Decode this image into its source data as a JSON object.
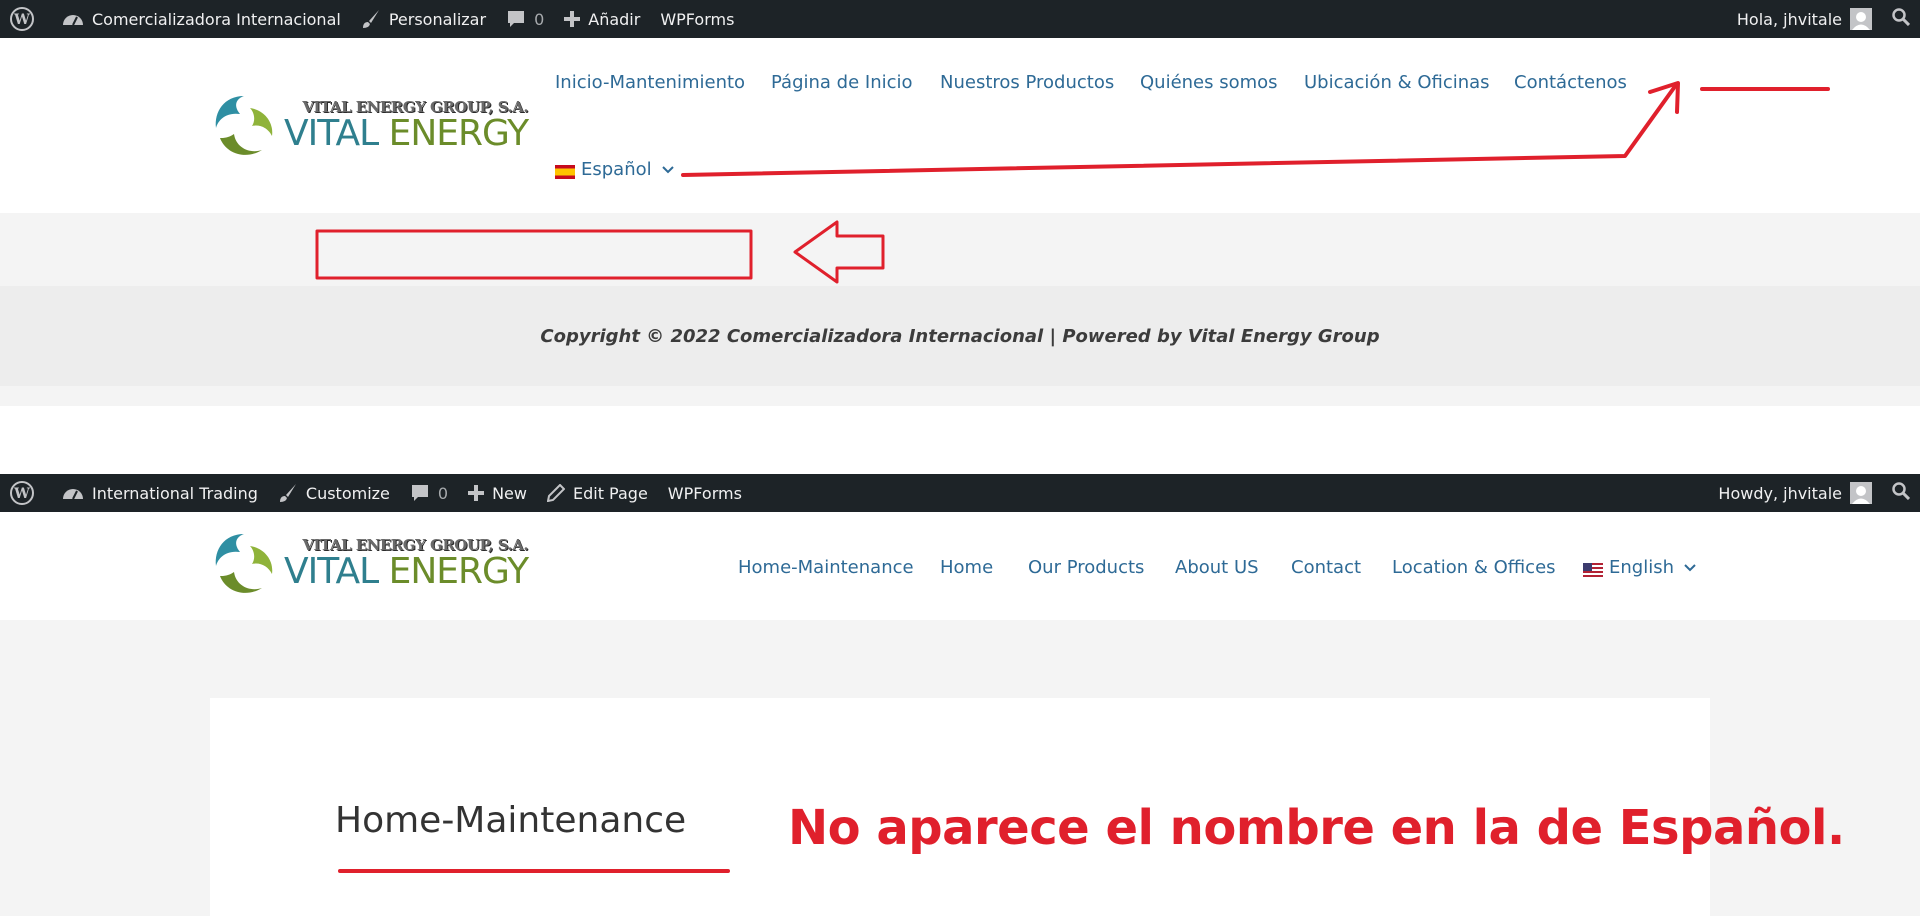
{
  "top": {
    "adminbar": {
      "site_name": "Comercializadora Internacional",
      "customize": "Personalizar",
      "comments_count": "0",
      "new": "Añadir",
      "wpforms": "WPForms",
      "greeting": "Hola, jhvitale"
    },
    "logo": {
      "small": "VITAL ENERGY GROUP, S.A.",
      "word1": "VITAL",
      "word2": "ENERGY"
    },
    "nav": [
      "Inicio-Mantenimiento",
      "Página de Inicio",
      "Nuestros Productos",
      "Quiénes somos",
      "Ubicación & Oficinas",
      "Contáctenos"
    ],
    "language": "Español",
    "copyright": "Copyright © 2022 Comercializadora Internacional | Powered by Vital Energy Group"
  },
  "bottom": {
    "adminbar": {
      "site_name": "International Trading",
      "customize": "Customize",
      "comments_count": "0",
      "new": "New",
      "edit_page": "Edit Page",
      "wpforms": "WPForms",
      "greeting": "Howdy, jhvitale"
    },
    "logo": {
      "small": "VITAL ENERGY GROUP, S.A.",
      "word1": "VITAL",
      "word2": "ENERGY"
    },
    "nav": [
      "Home-Maintenance",
      "Home",
      "Our Products",
      "About US",
      "Contact",
      "Location & Offices"
    ],
    "language": "English",
    "page_title": "Home-Maintenance"
  },
  "annotation": {
    "note": "No aparece el nombre en la de Español."
  },
  "colors": {
    "adminbar": "#1d2327",
    "link": "#2e6a96",
    "annotation": "#e0202c"
  }
}
